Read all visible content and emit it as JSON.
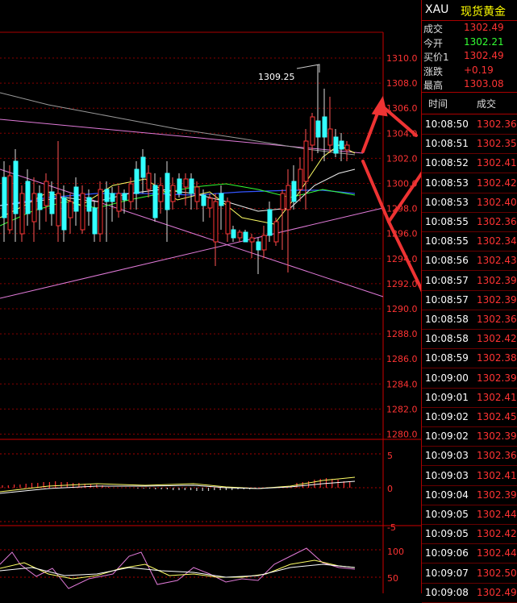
{
  "colors": {
    "background": "#000000",
    "axis_red": "#cc0000",
    "up": "#ff3333",
    "down": "#33ffff",
    "gold_label": "#ffff00",
    "flat_green": "#33ff33"
  },
  "price_axis": {
    "ticks": [
      "1310.0",
      "1308.0",
      "1306.0",
      "1304.0",
      "1302.0",
      "1300.0",
      "1298.0",
      "1296.0",
      "1294.0",
      "1292.0",
      "1290.0",
      "1288.0",
      "1286.0",
      "1284.0",
      "1282.0",
      "1280.0"
    ]
  },
  "peak_label": "1309.25",
  "macd_axis": {
    "ticks": [
      "5",
      "0",
      "-5"
    ]
  },
  "osc_axis": {
    "ticks": [
      "100",
      "50"
    ]
  },
  "panel": {
    "symbol": "XAU",
    "name": "现货黄金",
    "quotes": [
      {
        "label": "成交",
        "value": "1302.49",
        "color": "#ff3333"
      },
      {
        "label": "今开",
        "value": "1302.21",
        "color": "#33ff33"
      },
      {
        "label": "买价1",
        "value": "1302.49",
        "color": "#ff3333"
      },
      {
        "label": "涨跌",
        "value": "+0.19",
        "color": "#ff3333"
      },
      {
        "label": "最高",
        "value": "1303.08",
        "color": "#ff3333"
      }
    ],
    "trades_header": {
      "time": "时间",
      "price": "成交"
    },
    "trades": [
      {
        "time": "10:08:50",
        "price": "1302.36"
      },
      {
        "time": "10:08:51",
        "price": "1302.35"
      },
      {
        "time": "10:08:52",
        "price": "1302.41"
      },
      {
        "time": "10:08:53",
        "price": "1302.42"
      },
      {
        "time": "10:08:53",
        "price": "1302.40"
      },
      {
        "time": "10:08:55",
        "price": "1302.36"
      },
      {
        "time": "10:08:55",
        "price": "1302.34"
      },
      {
        "time": "10:08:56",
        "price": "1302.43"
      },
      {
        "time": "10:08:57",
        "price": "1302.39"
      },
      {
        "time": "10:08:57",
        "price": "1302.39"
      },
      {
        "time": "10:08:58",
        "price": "1302.36"
      },
      {
        "time": "10:08:58",
        "price": "1302.42"
      },
      {
        "time": "10:08:59",
        "price": "1302.38"
      },
      {
        "time": "10:09:00",
        "price": "1302.39"
      },
      {
        "time": "10:09:01",
        "price": "1302.41"
      },
      {
        "time": "10:09:02",
        "price": "1302.45"
      },
      {
        "time": "10:09:02",
        "price": "1302.39"
      },
      {
        "time": "10:09:03",
        "price": "1302.36"
      },
      {
        "time": "10:09:03",
        "price": "1302.41"
      },
      {
        "time": "10:09:04",
        "price": "1302.39"
      },
      {
        "time": "10:09:05",
        "price": "1302.44"
      },
      {
        "time": "10:09:05",
        "price": "1302.42"
      },
      {
        "time": "10:09:06",
        "price": "1302.44"
      },
      {
        "time": "10:09:07",
        "price": "1302.50"
      },
      {
        "time": "10:09:08",
        "price": "1302.49"
      }
    ]
  }
}
